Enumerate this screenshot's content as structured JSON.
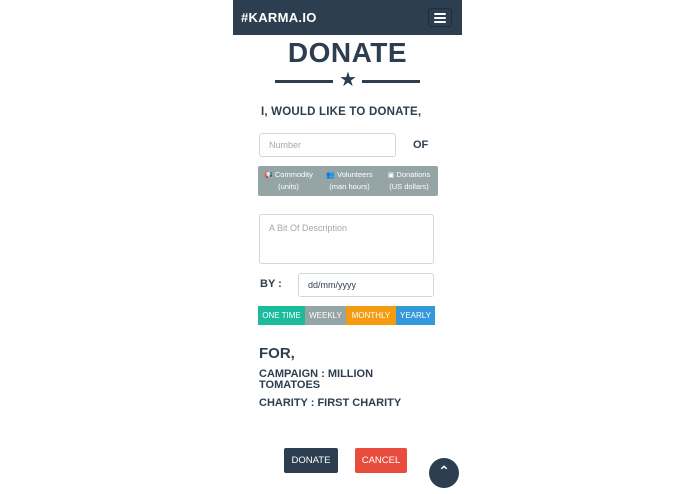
{
  "navbar": {
    "brand": "#KARMA.IO",
    "menu_icon": "hamburger-icon"
  },
  "page": {
    "title": "DONATE",
    "divider_icon": "star-icon"
  },
  "form": {
    "intro": "I, WOULD LIKE TO DONATE,",
    "number_placeholder": "Number",
    "of_label": "OF",
    "types": [
      {
        "icon": "megaphone-icon",
        "label": "Commodity",
        "sub": "(units)"
      },
      {
        "icon": "users-icon",
        "label": "Volunteers",
        "sub": "(man hours)"
      },
      {
        "icon": "money-icon",
        "label": "Donations",
        "sub": "(US dollars)"
      }
    ],
    "description_placeholder": "A Bit Of Description",
    "by_label": "BY :",
    "date_value": "dd/mm/yyyy",
    "frequency": [
      {
        "label": "ONE TIME",
        "color": "#1abc9c"
      },
      {
        "label": "WEEKLY",
        "color": "#95a5a6"
      },
      {
        "label": "MONTHLY",
        "color": "#f39c12"
      },
      {
        "label": "YEARLY",
        "color": "#3498db"
      }
    ]
  },
  "target": {
    "for_label": "FOR,",
    "campaign_line1": "CAMPAIGN : MILLION",
    "campaign_line2": "TOMATOES",
    "charity": "CHARITY : FIRST CHARITY"
  },
  "actions": {
    "donate_label": "DONATE",
    "cancel_label": "CANCEL",
    "donate_color": "#2c3e50",
    "cancel_color": "#e74c3c",
    "scroll_top_icon": "chevron-up-icon"
  },
  "colors": {
    "primary": "#2c3e50",
    "secondary": "#95a5a6"
  }
}
